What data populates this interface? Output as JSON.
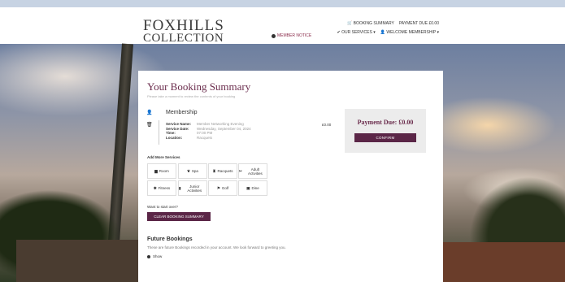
{
  "header": {
    "logo_line1": "FOXHILLS",
    "logo_line2": "COLLECTION",
    "booking_summary": "BOOKING SUMMARY",
    "payment_due": "PAYMENT DUE £0.00",
    "our_services": "OUR SERVICES",
    "welcome": "WELCOME MEMBERSHIP",
    "member_notice": "MEMBER NOTICE"
  },
  "summary": {
    "title": "Your Booking Summary",
    "subtitle": "Please take a moment to review the contents of your booking",
    "item_title": "Membership",
    "details": [
      {
        "k": "Service Name:",
        "v": "Member Networking Evening"
      },
      {
        "k": "Service Date:",
        "v": "Wednesday, September 04, 2024"
      },
      {
        "k": "Time:",
        "v": "07:00 PM"
      },
      {
        "k": "Location:",
        "v": "Racquets"
      }
    ],
    "price": "£0.00",
    "payment_label": "Payment Due: £0.00",
    "confirm_label": "CONFIRM",
    "add_more_label": "Add More Services",
    "services": [
      {
        "label": "Room",
        "icon": "bed-icon"
      },
      {
        "label": "Spa",
        "icon": "spa-icon"
      },
      {
        "label": "Racquets",
        "icon": "racquets-icon"
      },
      {
        "label": "Adult Activities",
        "icon": "activities-icon"
      },
      {
        "label": "Fitness",
        "icon": "fitness-icon"
      },
      {
        "label": "Junior Activities",
        "icon": "junior-icon"
      },
      {
        "label": "Golf",
        "icon": "golf-icon"
      },
      {
        "label": "Dine",
        "icon": "dine-icon"
      }
    ],
    "start_over_text": "Want to start over?",
    "clear_label": "CLEAR BOOKING SUMMARY"
  },
  "future": {
    "title": "Future Bookings",
    "text": "These are future Bookings recorded in your account. We look forward to greeting you.",
    "show_label": "Show"
  },
  "colors": {
    "brand": "#5b2647",
    "title": "#6b2d4d"
  }
}
